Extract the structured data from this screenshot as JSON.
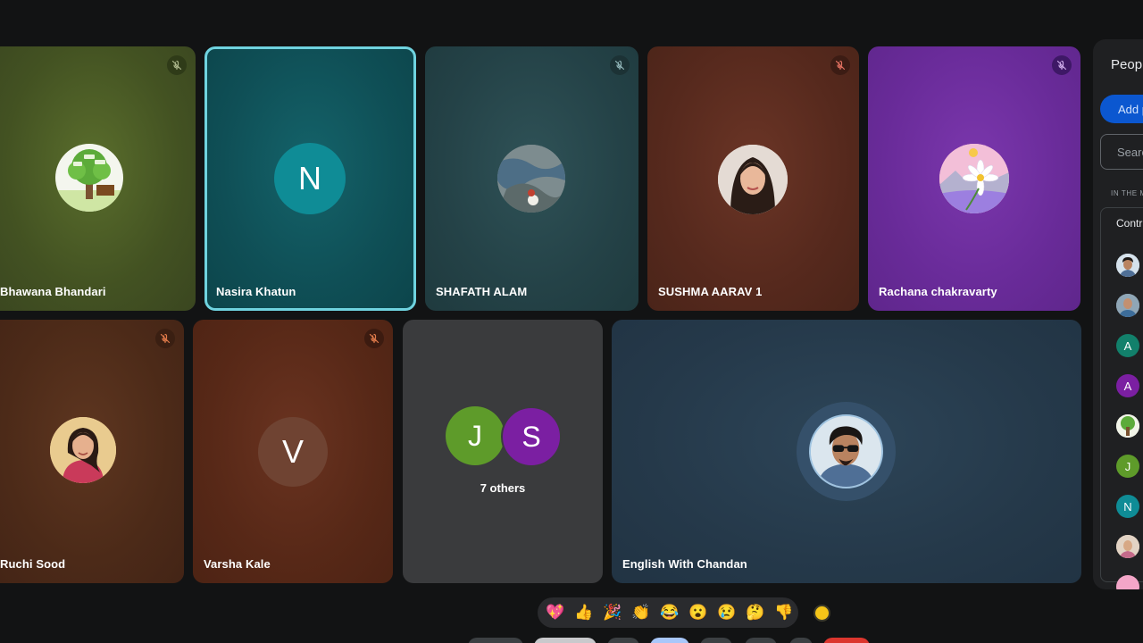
{
  "participants": [
    {
      "name": "Bhawana Bhandari",
      "muted": true
    },
    {
      "name": "Nasira Khatun",
      "initial": "N",
      "speaking": true
    },
    {
      "name": "SHAFATH ALAM",
      "muted": true
    },
    {
      "name": "SUSHMA AARAV 1",
      "muted": true
    },
    {
      "name": "Rachana chakravarty",
      "muted": true
    },
    {
      "name": "Ruchi Sood",
      "muted": true
    },
    {
      "name": "Varsha Kale",
      "initial": "V",
      "muted": true
    },
    {
      "name": "English With Chandan"
    }
  ],
  "others": {
    "initials": [
      "J",
      "S"
    ],
    "label": "7 others"
  },
  "sidebar": {
    "title": "People",
    "add_label": "Add people",
    "search_placeholder": "Search for people",
    "section_label": "IN THE MEETING",
    "contributors_label": "Contributors",
    "list_initials": [
      "A",
      "A",
      "J",
      "N"
    ]
  },
  "reactions": [
    {
      "icon": "sparkling-heart-icon",
      "glyph": "💖"
    },
    {
      "icon": "thumbs-up-icon",
      "glyph": "👍"
    },
    {
      "icon": "party-popper-icon",
      "glyph": "🎉"
    },
    {
      "icon": "clapping-hands-icon",
      "glyph": "👏"
    },
    {
      "icon": "tears-of-joy-icon",
      "glyph": "😂"
    },
    {
      "icon": "surprised-face-icon",
      "glyph": "😮"
    },
    {
      "icon": "sad-face-icon",
      "glyph": "😢"
    },
    {
      "icon": "thinking-face-icon",
      "glyph": "🤔"
    },
    {
      "icon": "thumbs-down-icon",
      "glyph": "👎"
    }
  ],
  "colors": {
    "accent_blue": "#0b57d0",
    "speaking_outline": "#6fd3df",
    "avatar_teal": "#0f8c96",
    "avatar_green": "#5e9b2a",
    "avatar_purple": "#7b1fa2"
  }
}
